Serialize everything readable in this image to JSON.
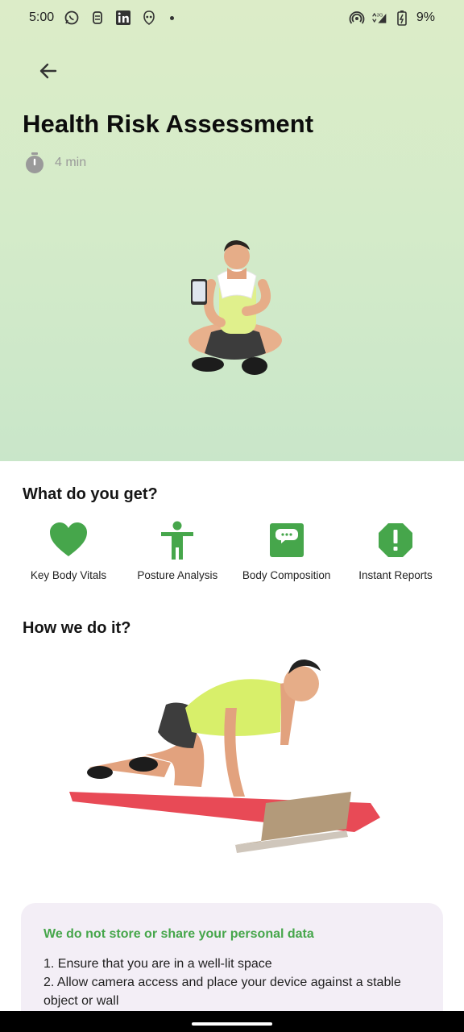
{
  "status_bar": {
    "time": "5:00",
    "battery": "9%",
    "network": "3G"
  },
  "header": {
    "title": "Health Risk Assessment",
    "duration": "4 min"
  },
  "what_section": {
    "title": "What do you get?",
    "features": [
      {
        "label": "Key Body Vitals",
        "icon": "heart-icon"
      },
      {
        "label": "Posture Analysis",
        "icon": "person-icon"
      },
      {
        "label": "Body Composition",
        "icon": "chat-bubble-icon"
      },
      {
        "label": "Instant Reports",
        "icon": "alert-octagon-icon"
      }
    ]
  },
  "how_section": {
    "title": "How we do it?"
  },
  "info_card": {
    "title": "We do not store or share your personal data",
    "steps": [
      "1. Ensure that you are in a well-lit space",
      "2. Allow camera access and place your device against a stable object or wall"
    ]
  },
  "colors": {
    "accent": "#46a64b",
    "hero_top": "#dcecc8",
    "hero_bottom": "#c9e6c9",
    "card_bg": "#f3eef6"
  }
}
